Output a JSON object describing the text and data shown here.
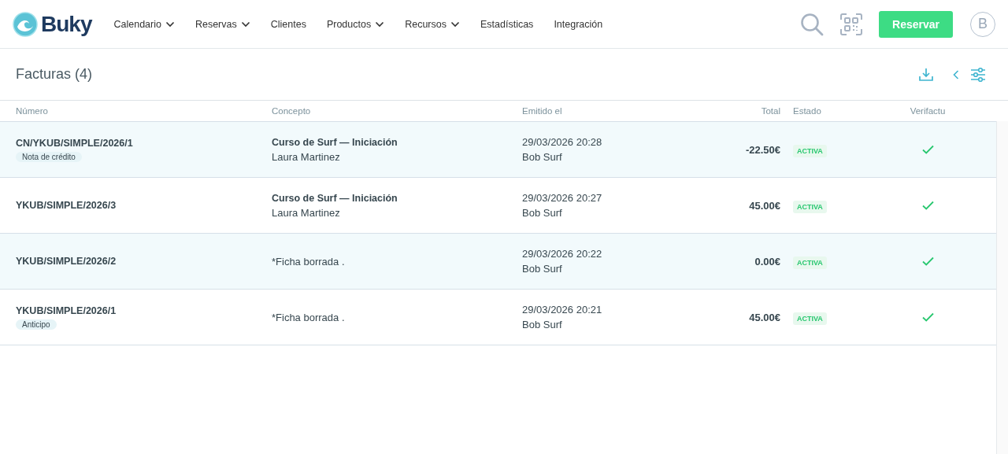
{
  "brand": "Buky",
  "nav": [
    {
      "label": "Calendario",
      "dropdown": true
    },
    {
      "label": "Reservas",
      "dropdown": true
    },
    {
      "label": "Clientes",
      "dropdown": false
    },
    {
      "label": "Productos",
      "dropdown": true
    },
    {
      "label": "Recursos",
      "dropdown": true
    },
    {
      "label": "Estadísticas",
      "dropdown": false
    },
    {
      "label": "Integración",
      "dropdown": false
    }
  ],
  "reserve_button": "Reservar",
  "avatar": "B",
  "page_title": "Facturas (4)",
  "table": {
    "columns": [
      "Número",
      "Concepto",
      "Emitido el",
      "Total",
      "Estado",
      "Verifactu"
    ],
    "rows": [
      {
        "number": "CN/YKUB/SIMPLE/2026/1",
        "tag": "Nota de crédito",
        "concept": "Curso de Surf — Iniciación",
        "concept_bold": true,
        "client": "Laura Martinez",
        "date": "29/03/2026 20:28",
        "issuer": "Bob Surf",
        "total": "-22.50€",
        "status": "ACTIVA",
        "verified": true
      },
      {
        "number": "YKUB/SIMPLE/2026/3",
        "concept": "Curso de Surf — Iniciación",
        "concept_bold": true,
        "client": "Laura Martinez",
        "date": "29/03/2026 20:27",
        "issuer": "Bob Surf",
        "total": "45.00€",
        "status": "ACTIVA",
        "verified": true
      },
      {
        "number": "YKUB/SIMPLE/2026/2",
        "concept": "*Ficha borrada .",
        "concept_bold": false,
        "date": "29/03/2026 20:22",
        "issuer": "Bob Surf",
        "total": "0.00€",
        "status": "ACTIVA",
        "verified": true
      },
      {
        "number": "YKUB/SIMPLE/2026/1",
        "tag": "Anticipo",
        "concept": "*Ficha borrada .",
        "concept_bold": false,
        "date": "29/03/2026 20:21",
        "issuer": "Bob Surf",
        "total": "45.00€",
        "status": "ACTIVA",
        "verified": true
      }
    ]
  }
}
